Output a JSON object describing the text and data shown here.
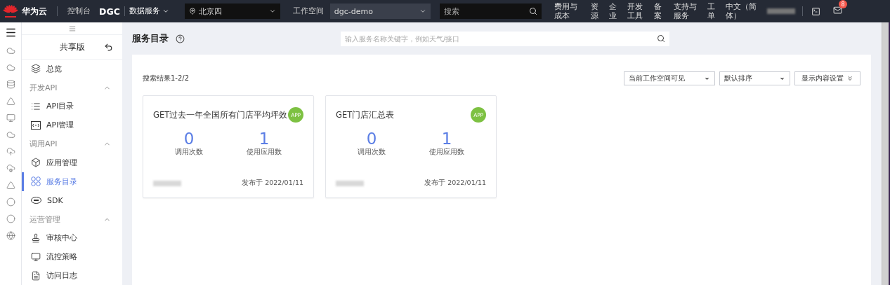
{
  "topbar": {
    "brand": "华为云",
    "console": "控制台",
    "product": "DGC",
    "service": "数据服务",
    "region": "北京四",
    "workspace_label": "工作空间",
    "workspace": "dgc-demo",
    "search": {
      "placeholder": "搜索"
    },
    "nav": [
      "费用与成本",
      "资源",
      "企业",
      "开发工具",
      "备案",
      "支持与服务",
      "工单",
      "中文（简体）"
    ],
    "notifications": "8"
  },
  "sidebar": {
    "title": "共享版",
    "items": [
      {
        "kind": "item",
        "label": "总览",
        "selected": false
      },
      {
        "kind": "group",
        "label": "开发API",
        "expanded": true,
        "children": [
          {
            "label": "API目录",
            "selected": false
          },
          {
            "label": "API管理",
            "selected": false
          }
        ]
      },
      {
        "kind": "group",
        "label": "调用API",
        "expanded": true,
        "children": [
          {
            "label": "应用管理",
            "selected": false
          },
          {
            "label": "服务目录",
            "selected": true
          },
          {
            "label": "SDK",
            "selected": false
          }
        ]
      },
      {
        "kind": "group",
        "label": "运营管理",
        "expanded": true,
        "children": [
          {
            "label": "审核中心",
            "selected": false
          },
          {
            "label": "流控策略",
            "selected": false
          },
          {
            "label": "访问日志",
            "selected": false
          }
        ]
      }
    ]
  },
  "main": {
    "title": "服务目录",
    "search": {
      "placeholder": "输入服务名称关键字，例如天气/接口"
    },
    "result": "搜索结果1-2/2",
    "filters": [
      "当前工作空间可见",
      "默认排序"
    ],
    "display_button": "显示内容设置",
    "cards": [
      {
        "title": "GET过去一年全国所有门店平均坪效",
        "badge": "APP",
        "stats": [
          {
            "value": "0",
            "label": "调用次数"
          },
          {
            "value": "1",
            "label": "使用应用数"
          }
        ],
        "date": "发布于 2022/01/11"
      },
      {
        "title": "GET门店汇总表",
        "badge": "APP",
        "stats": [
          {
            "value": "0",
            "label": "调用次数"
          },
          {
            "value": "1",
            "label": "使用应用数"
          }
        ],
        "date": "发布于 2022/01/11"
      }
    ]
  }
}
